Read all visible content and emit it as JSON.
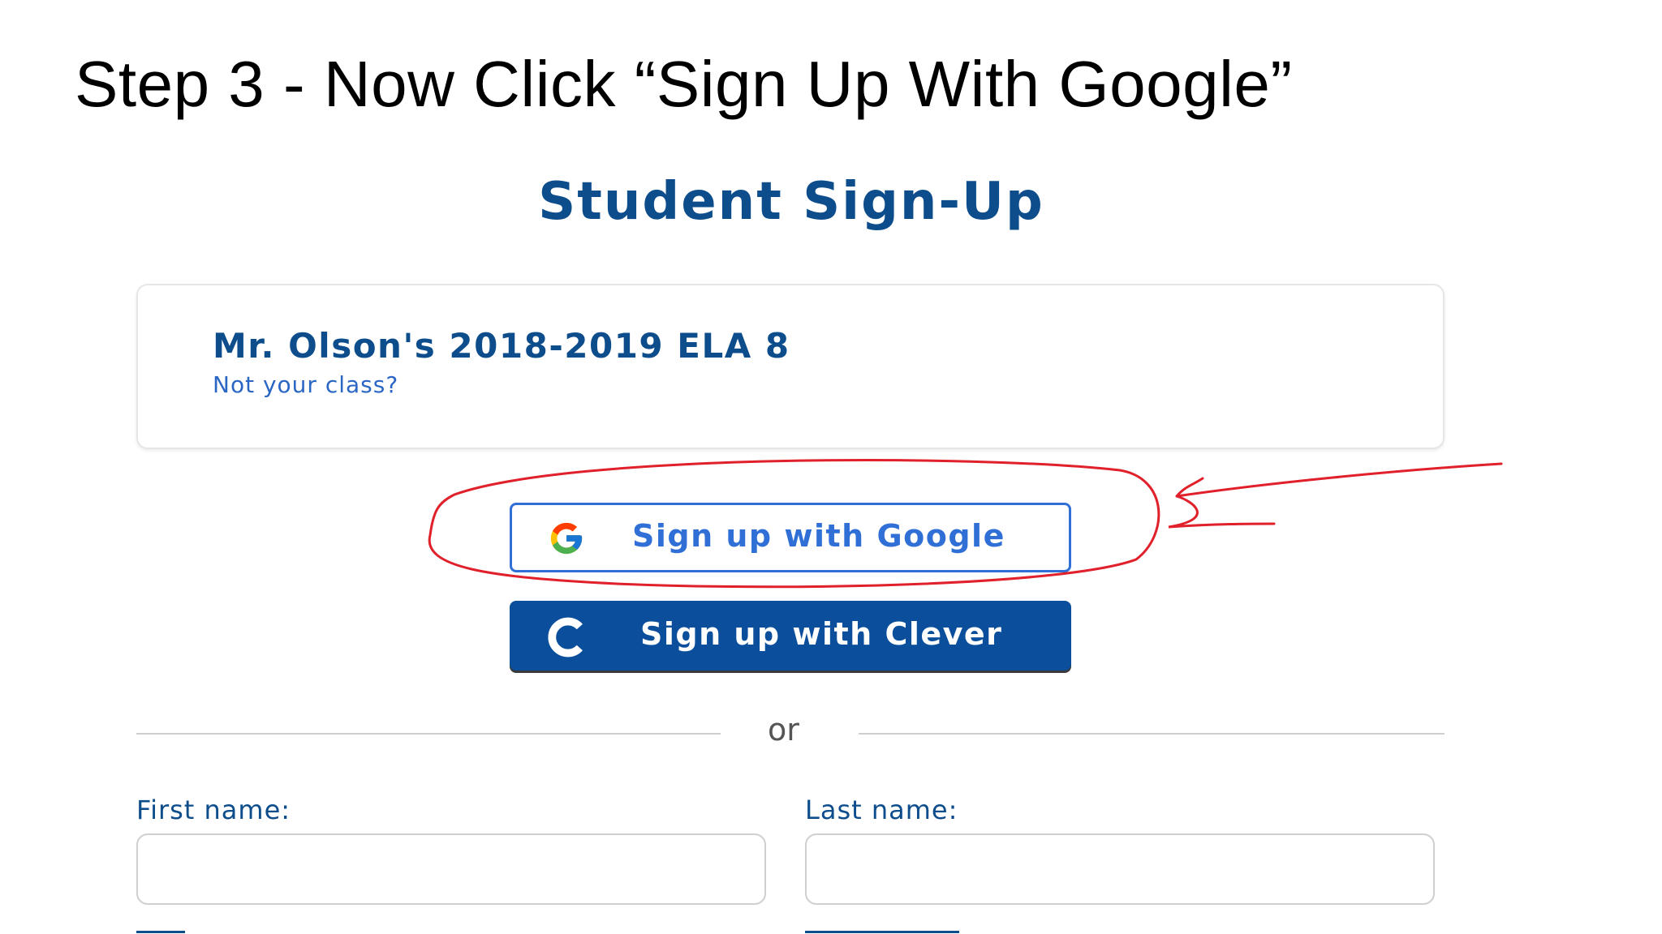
{
  "slide": {
    "title": "Step 3 - Now Click “Sign Up With Google”"
  },
  "signup": {
    "heading": "Student Sign-Up",
    "class_name": "Mr. Olson's 2018-2019 ELA 8",
    "not_your_class": "Not your class?",
    "google_button": "Sign up with Google",
    "clever_button": "Sign up with Clever",
    "or": "or",
    "first_name_label": "First name:",
    "last_name_label": "Last name:"
  },
  "colors": {
    "brand_blue": "#0d4d8c",
    "google_border": "#2f6fd6",
    "clever_bg": "#0b4f9c",
    "annotation_red": "#e0202a"
  },
  "icons": {
    "google": "google-g-icon",
    "clever": "clever-c-icon"
  }
}
